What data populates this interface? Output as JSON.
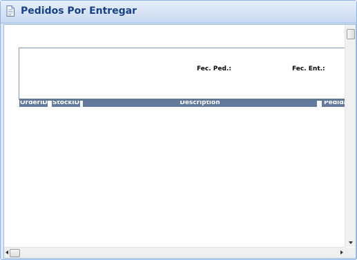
{
  "window": {
    "title": "Pedidos Por Entregar",
    "icon": "document-icon"
  },
  "report": {
    "fec_ped_label": "Fec. Ped.:",
    "fec_ent_label": "Fec. Ent.:",
    "columns": [
      "OrderID:",
      "StockID",
      "Description",
      "Pedida"
    ]
  },
  "colors": {
    "title_text": "#15428b",
    "header_bg": "#63799e",
    "header_text": "#ffffff"
  }
}
